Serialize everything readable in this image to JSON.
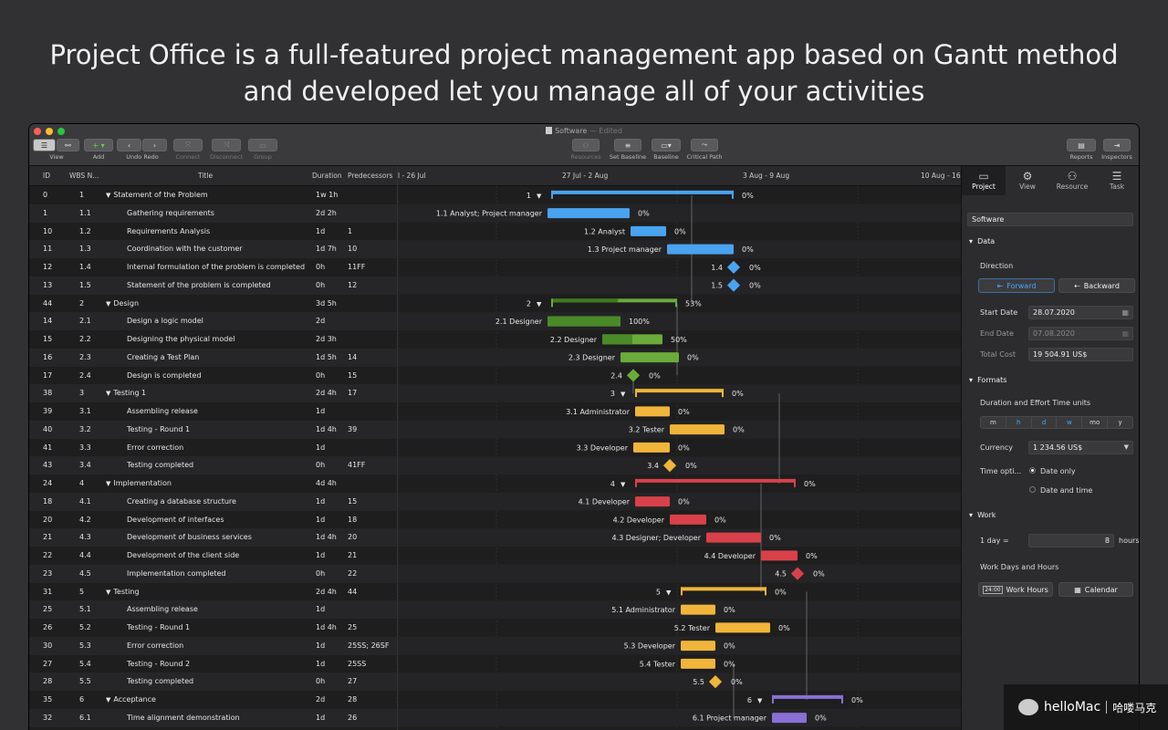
{
  "hero": {
    "line1": "Project Office is a full-featured project management app based on Gantt method",
    "line2": "and developed  let you manage all of your activities"
  },
  "window": {
    "doc_name": "Software",
    "status": "— Edited"
  },
  "toolbar": {
    "view_label": "View",
    "add_label": "Add",
    "undo_label": "Undo",
    "redo_label": "Redo",
    "connect_label": "Connect",
    "disconnect_label": "Disconnect",
    "group_label": "Group",
    "resources_label": "Resources",
    "set_baseline_label": "Set Baseline",
    "baseline_label": "Baseline",
    "critical_path_label": "Critical Path",
    "reports_label": "Reports",
    "inspectors_label": "Inspectors"
  },
  "columns": {
    "id": "ID",
    "wbs": "WBS N...",
    "title": "Title",
    "duration": "Duration",
    "predecessors": "Predecessors"
  },
  "timeline": {
    "weeks": [
      "l - 26 Jul",
      "27 Jul - 2 Aug",
      "3 Aug - 9 Aug",
      "10 Aug - 16"
    ]
  },
  "tasks": [
    {
      "id": "0",
      "wbs": "1",
      "title": "Statement of the Problem",
      "duration": "1w 1h",
      "pred": "",
      "summary": true
    },
    {
      "id": "1",
      "wbs": "1.1",
      "title": "Gathering requirements",
      "duration": "2d 2h",
      "pred": ""
    },
    {
      "id": "10",
      "wbs": "1.2",
      "title": "Requirements Analysis",
      "duration": "1d",
      "pred": "1"
    },
    {
      "id": "11",
      "wbs": "1.3",
      "title": "Coordination with the customer",
      "duration": "1d 7h",
      "pred": "10"
    },
    {
      "id": "12",
      "wbs": "1.4",
      "title": "Internal formulation of the problem is completed",
      "duration": "0h",
      "pred": "11FF"
    },
    {
      "id": "13",
      "wbs": "1.5",
      "title": "Statement of the problem is completed",
      "duration": "0h",
      "pred": "12"
    },
    {
      "id": "44",
      "wbs": "2",
      "title": "Design",
      "duration": "3d 5h",
      "pred": "",
      "summary": true
    },
    {
      "id": "14",
      "wbs": "2.1",
      "title": "Design a logic model",
      "duration": "2d",
      "pred": ""
    },
    {
      "id": "15",
      "wbs": "2.2",
      "title": "Designing the physical model",
      "duration": "2d 3h",
      "pred": ""
    },
    {
      "id": "16",
      "wbs": "2.3",
      "title": "Creating a Test Plan",
      "duration": "1d 5h",
      "pred": "14"
    },
    {
      "id": "17",
      "wbs": "2.4",
      "title": "Design is completed",
      "duration": "0h",
      "pred": "15"
    },
    {
      "id": "38",
      "wbs": "3",
      "title": "Testing 1",
      "duration": "2d 4h",
      "pred": "17",
      "summary": true
    },
    {
      "id": "39",
      "wbs": "3.1",
      "title": "Assembling release",
      "duration": "1d",
      "pred": ""
    },
    {
      "id": "40",
      "wbs": "3.2",
      "title": "Testing - Round 1",
      "duration": "1d 4h",
      "pred": "39"
    },
    {
      "id": "41",
      "wbs": "3.3",
      "title": "Error correction",
      "duration": "1d",
      "pred": ""
    },
    {
      "id": "43",
      "wbs": "3.4",
      "title": "Testing completed",
      "duration": "0h",
      "pred": "41FF"
    },
    {
      "id": "24",
      "wbs": "4",
      "title": "Implementation",
      "duration": "4d 4h",
      "pred": "",
      "summary": true
    },
    {
      "id": "18",
      "wbs": "4.1",
      "title": "Creating a database structure",
      "duration": "1d",
      "pred": "15"
    },
    {
      "id": "20",
      "wbs": "4.2",
      "title": "Development of interfaces",
      "duration": "1d",
      "pred": "18"
    },
    {
      "id": "21",
      "wbs": "4.3",
      "title": "Development of business services",
      "duration": "1d 4h",
      "pred": "20"
    },
    {
      "id": "22",
      "wbs": "4.4",
      "title": "Development of the client side",
      "duration": "1d",
      "pred": "21"
    },
    {
      "id": "23",
      "wbs": "4.5",
      "title": "Implementation completed",
      "duration": "0h",
      "pred": "22"
    },
    {
      "id": "31",
      "wbs": "5",
      "title": "Testing",
      "duration": "2d 4h",
      "pred": "44",
      "summary": true
    },
    {
      "id": "25",
      "wbs": "5.1",
      "title": "Assembling release",
      "duration": "1d",
      "pred": ""
    },
    {
      "id": "26",
      "wbs": "5.2",
      "title": "Testing - Round 1",
      "duration": "1d 4h",
      "pred": "25"
    },
    {
      "id": "30",
      "wbs": "5.3",
      "title": "Error correction",
      "duration": "1d",
      "pred": "25SS; 26SF"
    },
    {
      "id": "27",
      "wbs": "5.4",
      "title": "Testing - Round 2",
      "duration": "1d",
      "pred": "25SS"
    },
    {
      "id": "28",
      "wbs": "5.5",
      "title": "Testing completed",
      "duration": "0h",
      "pred": "27"
    },
    {
      "id": "35",
      "wbs": "6",
      "title": "Acceptance",
      "duration": "2d",
      "pred": "28",
      "summary": true
    },
    {
      "id": "32",
      "wbs": "6.1",
      "title": "Time alignment demonstration",
      "duration": "1d",
      "pred": "26"
    }
  ],
  "bars": [
    {
      "label": "1",
      "pct": "0%",
      "kind": "summary",
      "color": "#4aa3f0",
      "progress": 0
    },
    {
      "label": "1.1   Analyst; Project manager",
      "pct": "0%",
      "kind": "task",
      "color": "#4aa3f0",
      "progress": 0
    },
    {
      "label": "1.2   Analyst",
      "pct": "0%",
      "kind": "task",
      "color": "#4aa3f0",
      "progress": 0
    },
    {
      "label": "1.3   Project manager",
      "pct": "0%",
      "kind": "task",
      "color": "#4aa3f0",
      "progress": 0
    },
    {
      "label": "1.4",
      "pct": "0%",
      "kind": "milestone",
      "color": "#4aa3f0",
      "progress": 0
    },
    {
      "label": "1.5",
      "pct": "0%",
      "kind": "milestone",
      "color": "#4aa3f0",
      "progress": 0
    },
    {
      "label": "2",
      "pct": "53%",
      "kind": "summary",
      "color": "#6aab3a",
      "progress": 0.53
    },
    {
      "label": "2.1   Designer",
      "pct": "100%",
      "kind": "task",
      "color": "#6aab3a",
      "progress": 1
    },
    {
      "label": "2.2   Designer",
      "pct": "50%",
      "kind": "task",
      "color": "#6aab3a",
      "progress": 0.5
    },
    {
      "label": "2.3   Designer",
      "pct": "0%",
      "kind": "task",
      "color": "#6aab3a",
      "progress": 0
    },
    {
      "label": "2.4",
      "pct": "0%",
      "kind": "milestone",
      "color": "#6aab3a",
      "progress": 0
    },
    {
      "label": "3",
      "pct": "0%",
      "kind": "summary",
      "color": "#f0b53a",
      "progress": 0
    },
    {
      "label": "3.1   Administrator",
      "pct": "0%",
      "kind": "task",
      "color": "#f0b53a",
      "progress": 0
    },
    {
      "label": "3.2   Tester",
      "pct": "0%",
      "kind": "task",
      "color": "#f0b53a",
      "progress": 0
    },
    {
      "label": "3.3   Developer",
      "pct": "0%",
      "kind": "task",
      "color": "#f0b53a",
      "progress": 0
    },
    {
      "label": "3.4",
      "pct": "0%",
      "kind": "milestone",
      "color": "#f0b53a",
      "progress": 0
    },
    {
      "label": "4",
      "pct": "0%",
      "kind": "summary",
      "color": "#d9414a",
      "progress": 0
    },
    {
      "label": "4.1   Developer",
      "pct": "0%",
      "kind": "task",
      "color": "#d9414a",
      "progress": 0
    },
    {
      "label": "4.2   Developer",
      "pct": "0%",
      "kind": "task",
      "color": "#d9414a",
      "progress": 0
    },
    {
      "label": "4.3   Designer; Developer",
      "pct": "0%",
      "kind": "task",
      "color": "#d9414a",
      "progress": 0
    },
    {
      "label": "4.4   Developer",
      "pct": "0%",
      "kind": "task",
      "color": "#d9414a",
      "progress": 0
    },
    {
      "label": "4.5",
      "pct": "0%",
      "kind": "milestone",
      "color": "#d9414a",
      "progress": 0
    },
    {
      "label": "5",
      "pct": "0%",
      "kind": "summary",
      "color": "#f0b53a",
      "progress": 0
    },
    {
      "label": "5.1   Administrator",
      "pct": "0%",
      "kind": "task",
      "color": "#f0b53a",
      "progress": 0
    },
    {
      "label": "5.2   Tester",
      "pct": "0%",
      "kind": "task",
      "color": "#f0b53a",
      "progress": 0
    },
    {
      "label": "5.3   Developer",
      "pct": "0%",
      "kind": "task",
      "color": "#f0b53a",
      "progress": 0
    },
    {
      "label": "5.4   Tester",
      "pct": "0%",
      "kind": "task",
      "color": "#f0b53a",
      "progress": 0
    },
    {
      "label": "5.5",
      "pct": "0%",
      "kind": "milestone",
      "color": "#f0b53a",
      "progress": 0
    },
    {
      "label": "6",
      "pct": "0%",
      "kind": "summary",
      "color": "#8a6fd6",
      "progress": 0
    },
    {
      "label": "6.1   Project manager",
      "pct": "0%",
      "kind": "task",
      "color": "#8a6fd6",
      "progress": 0
    }
  ],
  "inspector": {
    "tabs": [
      "Project",
      "View",
      "Resource",
      "Task"
    ],
    "project_name": "Software",
    "data_section": "Data",
    "direction_label": "Direction",
    "forward": "Forward",
    "backward": "Backward",
    "start_date_label": "Start Date",
    "start_date": "28.07.2020",
    "end_date_label": "End Date",
    "end_date": "07.08.2020",
    "total_cost_label": "Total Cost",
    "total_cost": "19 504.91 US$",
    "formats_section": "Formats",
    "units_label": "Duration and Effort Time units",
    "units": [
      "m",
      "h",
      "d",
      "w",
      "mo",
      "y"
    ],
    "currency_label": "Currency",
    "currency": "1 234.56 US$",
    "time_options_label": "Time opti...",
    "date_only": "Date only",
    "date_and_time": "Date and time",
    "work_section": "Work",
    "one_day": "1 day =",
    "hours_value": "8",
    "hours_label": "hours",
    "work_days_label": "Work Days and Hours",
    "work_hours_btn": "Work Hours",
    "calendar_btn": "Calendar"
  },
  "watermark": {
    "brand": "helloMac",
    "cn": "哈喽马克"
  }
}
